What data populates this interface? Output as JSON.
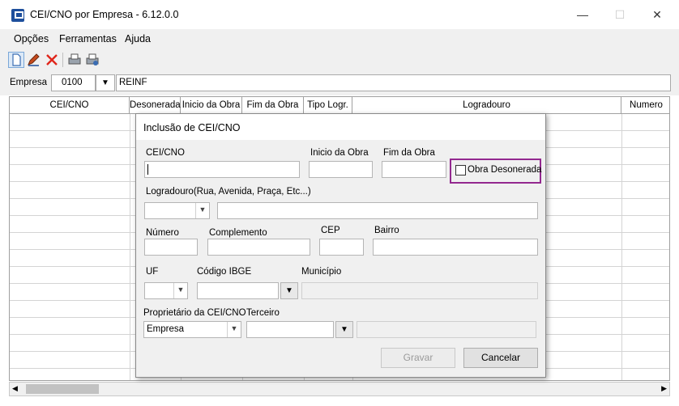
{
  "window": {
    "title": "CEI/CNO por Empresa - 6.12.0.0",
    "minimize_label": "—",
    "maximize_label": "☐",
    "close_label": "✕"
  },
  "menu": {
    "items": [
      "Opções",
      "Ferramentas",
      "Ajuda"
    ]
  },
  "toolbar": {
    "icons": [
      "new-document-icon",
      "edit-pencil-icon",
      "delete-x-icon",
      "print-icon",
      "print-setup-icon"
    ]
  },
  "empresa": {
    "label": "Empresa",
    "code": "0100",
    "name": "REINF"
  },
  "grid": {
    "columns": [
      "CEI/CNO",
      "Desonerada",
      "Inicio da Obra",
      "Fim da Obra",
      "Tipo Logr.",
      "Logradouro",
      "Numero"
    ]
  },
  "dialog": {
    "title": "Inclusão de CEI/CNO",
    "cei_label": "CEI/CNO",
    "cei_value": "",
    "inicio_label": "Inicio da Obra",
    "fim_label": "Fim da Obra",
    "desonerada_label": "Obra Desonerada",
    "desonerada_checked": false,
    "logradouro_label": "Logradouro(Rua, Avenida, Praça, Etc...)",
    "numero_label": "Número",
    "complemento_label": "Complemento",
    "cep_label": "CEP",
    "bairro_label": "Bairro",
    "uf_label": "UF",
    "ibge_label": "Código IBGE",
    "municipio_label": "Município",
    "proprietario_label": "Proprietário da CEI/CNO",
    "proprietario_value": "Empresa",
    "terceiro_label": "Terceiro",
    "gravar_label": "Gravar",
    "cancelar_label": "Cancelar"
  },
  "colors": {
    "highlight": "#93288f",
    "app_icon": "#1e4f9c"
  }
}
